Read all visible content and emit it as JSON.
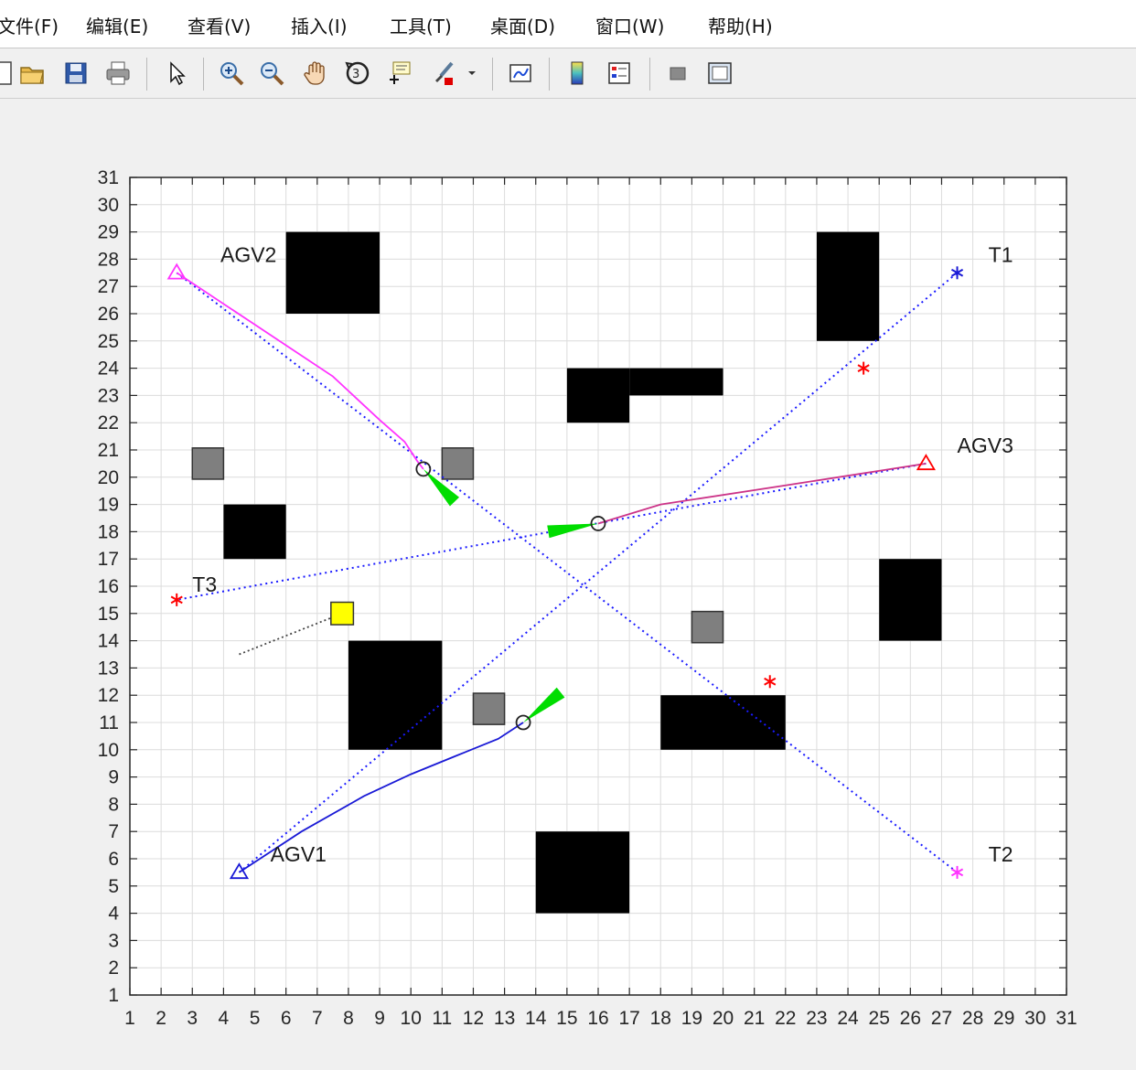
{
  "menubar": {
    "items": [
      "文件(F)",
      "编辑(E)",
      "查看(V)",
      "插入(I)",
      "工具(T)",
      "桌面(D)",
      "窗口(W)",
      "帮助(H)"
    ]
  },
  "toolbar": {
    "buttons": [
      "new-file-icon",
      "open-folder-icon",
      "save-icon",
      "print-icon",
      "pointer-icon",
      "zoom-in-icon",
      "zoom-out-icon",
      "pan-hand-icon",
      "rotate-3d-icon",
      "data-cursor-icon",
      "brush-icon",
      "link-plot-icon",
      "colorbar-icon",
      "legend-icon",
      "hide-plot-tools-icon",
      "show-plot-tools-icon"
    ]
  },
  "colors": {
    "agv1": "#1a1ad6",
    "agv2": "#ff33ff",
    "agv3_track": "#cc3388",
    "planned": "#1a1aff",
    "target_red": "#ff0000",
    "obstacle": "#000000",
    "dynamic_obstacle": "#7f7f7f",
    "heading": "#00dd00",
    "highlight": "#ffff00"
  },
  "chart_data": {
    "type": "scatter",
    "xlim": [
      1,
      31
    ],
    "ylim": [
      1,
      31
    ],
    "xticks": [
      "1",
      "2",
      "3",
      "4",
      "5",
      "6",
      "7",
      "8",
      "9",
      "10",
      "11",
      "12",
      "13",
      "14",
      "15",
      "16",
      "17",
      "18",
      "19",
      "20",
      "21",
      "22",
      "23",
      "24",
      "25",
      "26",
      "27",
      "28",
      "29",
      "30",
      "31"
    ],
    "yticks": [
      "1",
      "2",
      "3",
      "4",
      "5",
      "6",
      "7",
      "8",
      "9",
      "10",
      "11",
      "12",
      "13",
      "14",
      "15",
      "16",
      "17",
      "18",
      "19",
      "20",
      "21",
      "22",
      "23",
      "24",
      "25",
      "26",
      "27",
      "28",
      "29",
      "30",
      "31"
    ],
    "grid": true,
    "labels": [
      {
        "text": "AGV1",
        "x": 5.5,
        "y": 5.9
      },
      {
        "text": "AGV2",
        "x": 3.9,
        "y": 27.9
      },
      {
        "text": "AGV3",
        "x": 27.5,
        "y": 20.9
      },
      {
        "text": "T1",
        "x": 28.5,
        "y": 27.9
      },
      {
        "text": "T2",
        "x": 28.5,
        "y": 5.9
      },
      {
        "text": "T3",
        "x": 3.0,
        "y": 15.8
      }
    ],
    "obstacles": [
      {
        "x0": 6,
        "y0": 26,
        "x1": 9,
        "y1": 29
      },
      {
        "x0": 23,
        "y0": 25,
        "x1": 25,
        "y1": 29
      },
      {
        "x0": 15,
        "y0": 22,
        "x1": 17,
        "y1": 24
      },
      {
        "x0": 17,
        "y0": 23,
        "x1": 20,
        "y1": 24
      },
      {
        "x0": 4,
        "y0": 17,
        "x1": 6,
        "y1": 19
      },
      {
        "x0": 25,
        "y0": 14,
        "x1": 27,
        "y1": 17
      },
      {
        "x0": 8,
        "y0": 10,
        "x1": 11,
        "y1": 14
      },
      {
        "x0": 18,
        "y0": 10,
        "x1": 22,
        "y1": 12
      },
      {
        "x0": 14,
        "y0": 4,
        "x1": 17,
        "y1": 7
      }
    ],
    "dynamic_obstacles": [
      {
        "x": 3.5,
        "y": 20.5
      },
      {
        "x": 11.5,
        "y": 20.5
      },
      {
        "x": 19.5,
        "y": 14.5
      },
      {
        "x": 12.5,
        "y": 11.5
      }
    ],
    "highlight_cell": {
      "x": 7.8,
      "y": 15.0
    },
    "gray_dashed": [
      [
        4.5,
        13.5
      ],
      [
        7.8,
        15.0
      ]
    ],
    "start_markers": [
      {
        "name": "AGV1",
        "x": 4.5,
        "y": 5.5,
        "color": "#1a1ad6"
      },
      {
        "name": "AGV2",
        "x": 2.5,
        "y": 27.5,
        "color": "#ff33ff"
      },
      {
        "name": "AGV3",
        "x": 26.5,
        "y": 20.5,
        "color": "#ff0000"
      }
    ],
    "targets": [
      {
        "name": "T1",
        "x": 27.5,
        "y": 27.5,
        "color": "#1a1ad6"
      },
      {
        "name": "T2",
        "x": 27.5,
        "y": 5.5,
        "color": "#ff33ff"
      },
      {
        "name": "T3",
        "x": 2.5,
        "y": 15.5,
        "color": "#ff0000"
      }
    ],
    "waypoints": [
      {
        "x": 24.5,
        "y": 24.0
      },
      {
        "x": 21.5,
        "y": 12.5
      }
    ],
    "planned_paths": [
      [
        [
          4.5,
          5.5
        ],
        [
          27.5,
          27.5
        ]
      ],
      [
        [
          2.5,
          27.5
        ],
        [
          27.5,
          5.5
        ]
      ],
      [
        [
          26.5,
          20.5
        ],
        [
          2.5,
          15.5
        ]
      ]
    ],
    "actual_tracks": [
      {
        "name": "AGV1",
        "color": "#1a1ad6",
        "points": [
          [
            4.5,
            5.5
          ],
          [
            6.5,
            7.0
          ],
          [
            8.5,
            8.3
          ],
          [
            10.0,
            9.1
          ],
          [
            11.5,
            9.8
          ],
          [
            12.8,
            10.4
          ],
          [
            13.6,
            11.0
          ]
        ]
      },
      {
        "name": "AGV2",
        "color": "#ff33ff",
        "points": [
          [
            2.5,
            27.5
          ],
          [
            5.0,
            25.6
          ],
          [
            7.5,
            23.7
          ],
          [
            9.0,
            22.1
          ],
          [
            9.8,
            21.3
          ],
          [
            10.2,
            20.6
          ],
          [
            10.4,
            20.3
          ]
        ]
      },
      {
        "name": "AGV3",
        "color": "#cc3388",
        "points": [
          [
            26.5,
            20.5
          ],
          [
            22.0,
            19.7
          ],
          [
            18.0,
            19.0
          ],
          [
            16.0,
            18.3
          ]
        ]
      }
    ],
    "current_positions": [
      {
        "x": 13.6,
        "y": 11.0
      },
      {
        "x": 10.4,
        "y": 20.3
      },
      {
        "x": 16.0,
        "y": 18.3
      }
    ],
    "heading_wedges": [
      {
        "from": [
          13.6,
          11.0
        ],
        "tip": [
          14.8,
          12.1
        ]
      },
      {
        "from": [
          10.4,
          20.3
        ],
        "tip": [
          11.4,
          19.1
        ]
      },
      {
        "from": [
          16.0,
          18.3
        ],
        "tip": [
          14.4,
          18.0
        ]
      }
    ]
  }
}
